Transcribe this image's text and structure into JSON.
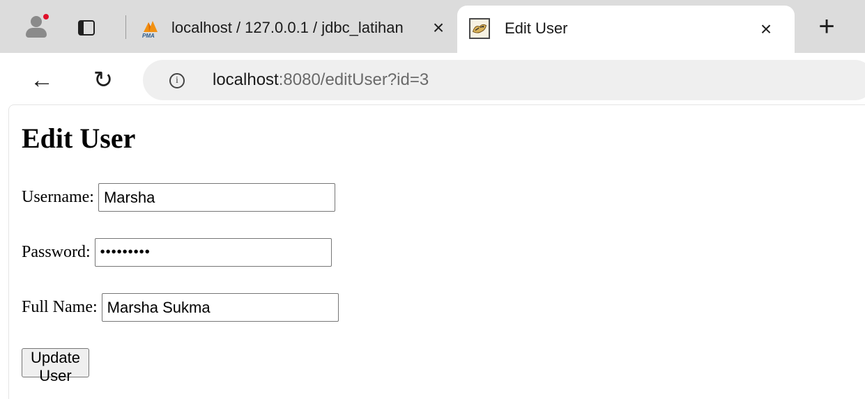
{
  "browser": {
    "tabs": [
      {
        "title": "localhost / 127.0.0.1 / jdbc_latihan",
        "icon": "phpmyadmin-icon",
        "active": false
      },
      {
        "title": "Edit User",
        "icon": "tomcat-icon",
        "active": true
      }
    ],
    "close_glyph": "×",
    "new_tab_glyph": "+",
    "back_glyph": "←",
    "reload_glyph": "↻",
    "info_glyph": "i",
    "url_host": "localhost",
    "url_rest": ":8080/editUser?id=3"
  },
  "page": {
    "heading": "Edit User",
    "form": {
      "username_label": "Username:",
      "username_value": "Marsha",
      "password_label": "Password:",
      "password_value": "•••••••••",
      "fullname_label": "Full Name:",
      "fullname_value": "Marsha Sukma",
      "submit_label": "Update User"
    }
  },
  "colors": {
    "tabbar_bg": "#dcdcdc",
    "profile_badge": "#e0102a",
    "omnibox_bg": "#efefef"
  }
}
